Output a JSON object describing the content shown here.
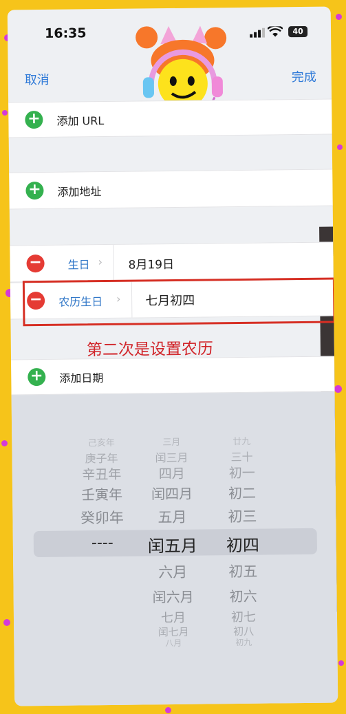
{
  "status": {
    "time": "16:35",
    "battery": "40"
  },
  "nav": {
    "cancel": "取消",
    "done": "完成"
  },
  "rows": {
    "add_url": "添加 URL",
    "add_address": "添加地址",
    "birthday_label": "生日",
    "birthday_value": "8月19日",
    "lunar_label": "农历生日",
    "lunar_value": "七月初四",
    "add_date": "添加日期"
  },
  "annotation": "第二次是设置农历",
  "picker": {
    "years": [
      "己亥年",
      "庚子年",
      "辛丑年",
      "壬寅年",
      "癸卯年",
      "----"
    ],
    "months": [
      "三月",
      "闰三月",
      "四月",
      "闰四月",
      "五月",
      "闰五月",
      "六月",
      "闰六月",
      "七月",
      "闰七月",
      "八月"
    ],
    "days": [
      "廿九",
      "三十",
      "初一",
      "初二",
      "初三",
      "初四",
      "初五",
      "初六",
      "初七",
      "初八",
      "初九"
    ]
  },
  "colors": {
    "accent": "#3278c8",
    "add": "#34b14f",
    "remove": "#e53b34",
    "annotation": "#d1252a",
    "background": "#f6c41a"
  }
}
